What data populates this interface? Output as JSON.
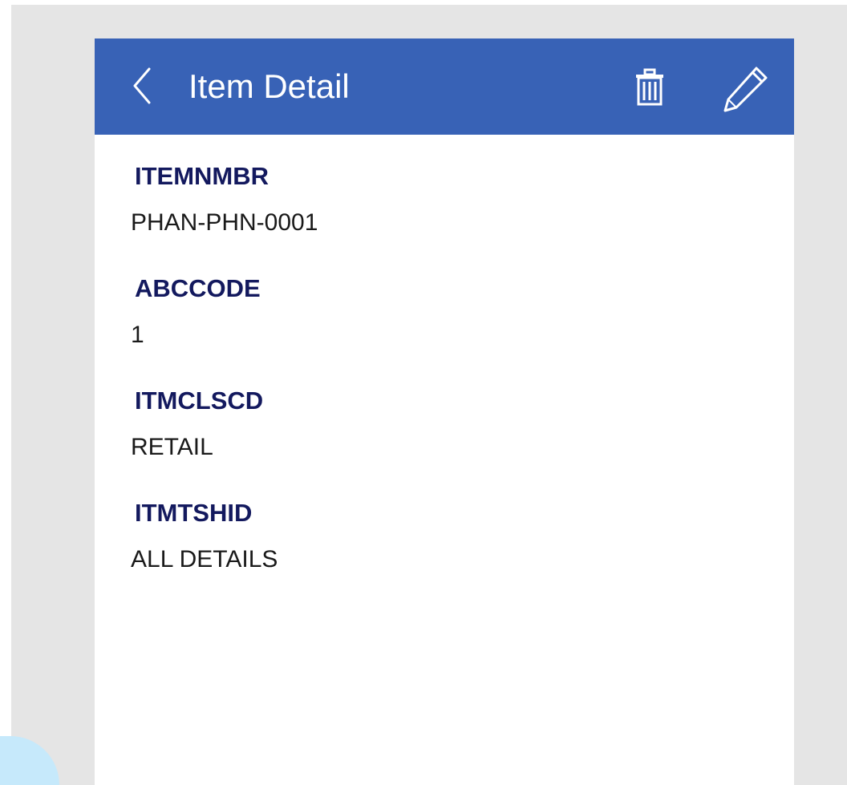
{
  "header": {
    "title": "Item Detail",
    "back_icon": "chevron-left-icon",
    "delete_icon": "trash-icon",
    "edit_icon": "pencil-icon"
  },
  "fields": [
    {
      "label": "ITEMNMBR",
      "value": "PHAN-PHN-0001"
    },
    {
      "label": "ABCCODE",
      "value": "1"
    },
    {
      "label": "ITMCLSCD",
      "value": "RETAIL"
    },
    {
      "label": "ITMTSHID",
      "value": "ALL DETAILS"
    }
  ],
  "colors": {
    "header_bg": "#3862b6",
    "label_text": "#13195e",
    "value_text": "#1a1a1a",
    "canvas_bg": "#e5e5e5"
  }
}
